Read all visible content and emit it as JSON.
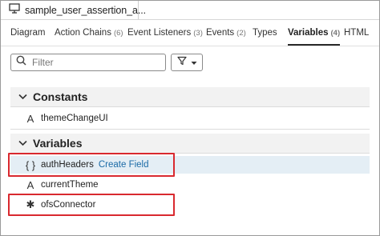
{
  "file_tab": {
    "icon": "monitor-icon",
    "name": "sample_user_assertion_a..."
  },
  "tabs": [
    {
      "label": "Diagram",
      "count": ""
    },
    {
      "label": "Action Chains",
      "count": "(6)"
    },
    {
      "label": "Event Listeners",
      "count": "(3)"
    },
    {
      "label": "Events",
      "count": "(2)"
    },
    {
      "label": "Types",
      "count": ""
    },
    {
      "label": "Variables",
      "count": "(4)"
    },
    {
      "label": "HTML",
      "count": ""
    }
  ],
  "active_tab": "Variables",
  "filter": {
    "placeholder": "Filter",
    "value": ""
  },
  "sections": {
    "constants": {
      "title": "Constants",
      "items": [
        {
          "icon": "A",
          "label": "themeChangeUI"
        }
      ]
    },
    "variables": {
      "title": "Variables",
      "items": [
        {
          "icon": "{ }",
          "label": "authHeaders",
          "action": "Create Field",
          "selected": true
        },
        {
          "icon": "A",
          "label": "currentTheme"
        },
        {
          "icon": "✱",
          "label": "ofsConnector"
        }
      ]
    }
  },
  "colors": {
    "highlight_box": "#d9292f",
    "link": "#1a6aa6",
    "selected_row": "#e4eef5"
  }
}
